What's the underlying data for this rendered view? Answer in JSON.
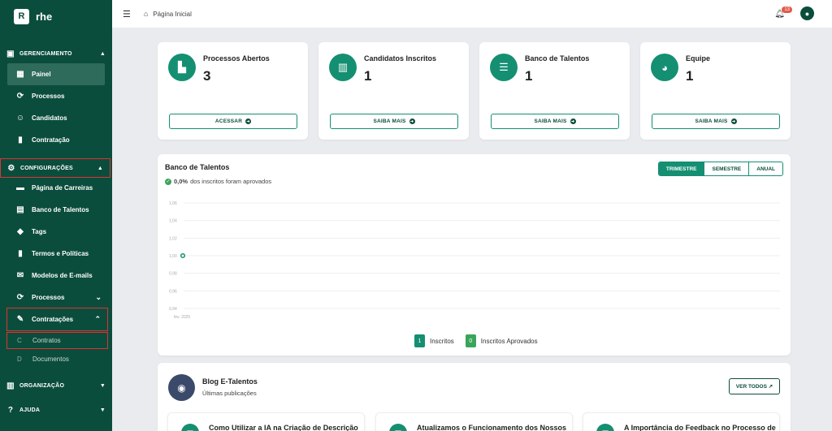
{
  "brand": {
    "logo_letter": "R",
    "name": "rhe"
  },
  "sidebar": {
    "gerenciamento": {
      "label": "GERENCIAMENTO",
      "items": [
        {
          "label": "Painel",
          "icon": "dashboard-icon"
        },
        {
          "label": "Processos",
          "icon": "process-icon"
        },
        {
          "label": "Candidatos",
          "icon": "people-icon"
        },
        {
          "label": "Contratação",
          "icon": "document-icon"
        }
      ]
    },
    "configuracoes": {
      "label": "CONFIGURAÇÕES",
      "items": [
        {
          "label": "Página de Carreiras",
          "icon": "folder-icon"
        },
        {
          "label": "Banco de Talentos",
          "icon": "contact-card-icon"
        },
        {
          "label": "Tags",
          "icon": "tag-icon"
        },
        {
          "label": "Termos e Políticas",
          "icon": "document-icon"
        },
        {
          "label": "Modelos de E-mails",
          "icon": "mail-icon"
        },
        {
          "label": "Processos",
          "icon": "process-icon"
        },
        {
          "label": "Contratações",
          "icon": "pencil-icon"
        }
      ],
      "sub_items": [
        {
          "letter": "C",
          "label": "Contratos"
        },
        {
          "letter": "D",
          "label": "Documentos"
        }
      ]
    },
    "organizacao": {
      "label": "ORGANIZAÇÃO"
    },
    "ajuda": {
      "label": "AJUDA"
    }
  },
  "topbar": {
    "breadcrumb": "Página Inicial",
    "notification_count": "13"
  },
  "stats": [
    {
      "title": "Processos Abertos",
      "value": "3",
      "button": "ACESSAR",
      "icon": "file-icon"
    },
    {
      "title": "Candidatos Inscritos",
      "value": "1",
      "button": "SAIBA MAIS",
      "icon": "bar-chart-icon"
    },
    {
      "title": "Banco de Talentos",
      "value": "1",
      "button": "SAIBA MAIS",
      "icon": "database-icon"
    },
    {
      "title": "Equipe",
      "value": "1",
      "button": "SAIBA MAIS",
      "icon": "pie-chart-icon"
    }
  ],
  "chart_panel": {
    "title": "Banco de Talentos",
    "subtitle_value": "0,0%",
    "subtitle_text": "dos inscritos foram aprovados",
    "periods": [
      "TRIMESTRE",
      "SEMESTRE",
      "ANUAL"
    ]
  },
  "chart_data": {
    "type": "line",
    "x": [
      "fev. 2025"
    ],
    "series": [
      {
        "name": "Inscritos",
        "values": [
          1
        ],
        "color": "#148f72"
      },
      {
        "name": "Inscritos Aprovados",
        "values": [
          0
        ],
        "color": "#3aa55a"
      }
    ],
    "yticks": [
      "1,06",
      "1,04",
      "1,02",
      "1,00",
      "0,98",
      "0,96",
      "0,94"
    ],
    "ylim": [
      0.94,
      1.06
    ],
    "legend": [
      {
        "count": "1",
        "label": "Inscritos",
        "color": "#148f72"
      },
      {
        "count": "0",
        "label": "Inscritos Aprovados",
        "color": "#3aa55a"
      }
    ]
  },
  "blog": {
    "title": "Blog E-Talentos",
    "subtitle": "Últimas publicações",
    "button": "VER TODOS",
    "posts": [
      {
        "title": "Como Utilizar a IA na Criação de Descrição"
      },
      {
        "title": "Atualizamos o Funcionamento dos Nossos"
      },
      {
        "title": "A Importância do Feedback no Processo de"
      }
    ]
  }
}
